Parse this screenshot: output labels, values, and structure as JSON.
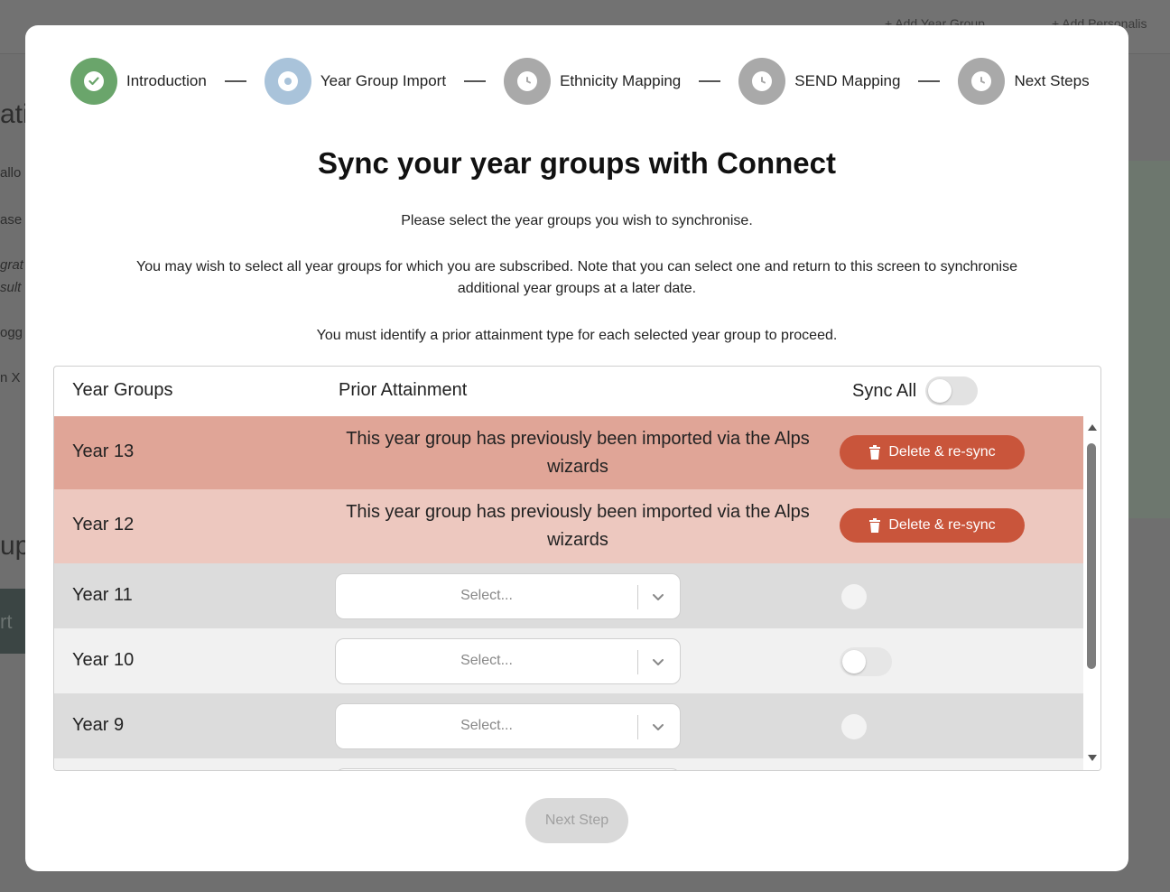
{
  "background": {
    "top_links": [
      "+ Add Year Group",
      "+ Add Personalis"
    ],
    "side_fragments": [
      "atio",
      "allo",
      "ase",
      "grat",
      "sult",
      "ogg",
      "n X",
      "up",
      "rt"
    ]
  },
  "stepper": {
    "steps": [
      {
        "label": "Introduction",
        "state": "done",
        "icon": "check-icon"
      },
      {
        "label": "Year Group Import",
        "state": "active",
        "icon": "dot-icon"
      },
      {
        "label": "Ethnicity Mapping",
        "state": "pending",
        "icon": "clock-icon"
      },
      {
        "label": "SEND Mapping",
        "state": "pending",
        "icon": "clock-icon"
      },
      {
        "label": "Next Steps",
        "state": "pending",
        "icon": "clock-icon"
      }
    ]
  },
  "heading": "Sync your year groups with Connect",
  "instructions": {
    "p1": "Please select the year groups you wish to synchronise.",
    "p2": "You may wish to select all year groups for which you are subscribed. Note that you can select one and return to this screen to synchronise additional year groups at a later date.",
    "p3": "You must identify a prior attainment type for each selected year group to proceed."
  },
  "table": {
    "headers": {
      "year": "Year Groups",
      "prior": "Prior Attainment",
      "sync_all": "Sync All"
    },
    "rows": [
      {
        "year": "Year 13",
        "message": "This year group has previously been imported via the Alps wizards",
        "action": "Delete & re-sync"
      },
      {
        "year": "Year 12",
        "message": "This year group has previously been imported via the Alps wizards",
        "action": "Delete & re-sync"
      },
      {
        "year": "Year 11",
        "select_placeholder": "Select..."
      },
      {
        "year": "Year 10",
        "select_placeholder": "Select..."
      },
      {
        "year": "Year 9",
        "select_placeholder": "Select..."
      }
    ]
  },
  "footer": {
    "next_label": "Next Step"
  },
  "colors": {
    "done": "#6aa56b",
    "active": "#a9c3da",
    "pending": "#a9a9a9",
    "danger_button": "#c9553b",
    "imported_row_dark": "#e0a597",
    "imported_row_light": "#edc8bf"
  }
}
